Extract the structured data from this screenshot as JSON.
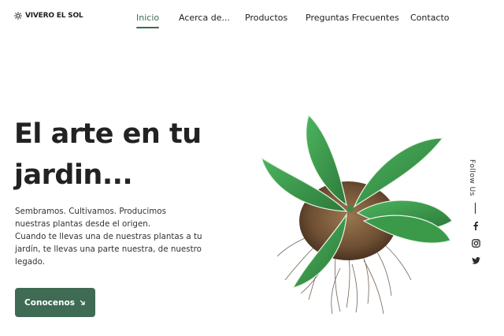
{
  "brand": {
    "name": "VIVERO EL SOL",
    "icon": "sun-icon"
  },
  "nav": {
    "items": [
      {
        "label": "Inicio",
        "active": true
      },
      {
        "label": "Acerca de..."
      },
      {
        "label": "Productos"
      },
      {
        "label": "Preguntas Frecuentes"
      },
      {
        "label": "Contacto"
      }
    ]
  },
  "hero": {
    "title_line1": "El arte en tu",
    "title_line2": "jardin...",
    "description": [
      "Sembramos. Cultivamos. Producimos",
      "nuestras plantas desde el origen.",
      "Cuando te llevas una de nuestras plantas a tu",
      "jardín, te llevas una parte nuestra, de nuestro",
      "legado."
    ],
    "cta_label": "Conocenos",
    "cta_icon": "arrow-down-right-icon"
  },
  "social": {
    "label": "Follow Us",
    "icons": [
      "facebook-icon",
      "instagram-icon",
      "twitter-icon"
    ]
  },
  "colors": {
    "accent": "#3f6a53",
    "text": "#1f1f1f",
    "leaf": "#3d9a4e",
    "soil": "#7a5a3a"
  }
}
